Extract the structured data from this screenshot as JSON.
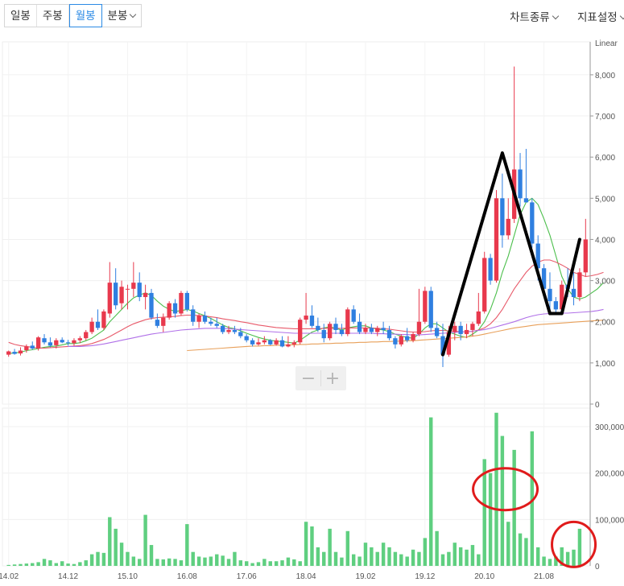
{
  "toolbar": {
    "period_tabs": [
      {
        "label": "일봉",
        "active": false
      },
      {
        "label": "주봉",
        "active": false
      },
      {
        "label": "월봉",
        "active": true
      },
      {
        "label": "분봉",
        "active": false,
        "dropdown": true
      }
    ],
    "chart_type_label": "차트종류",
    "indicator_label": "지표설정"
  },
  "zoom": {
    "minus": "−",
    "plus": "+"
  },
  "colors": {
    "up": "#e8394d",
    "down": "#2f7fe0",
    "volume": "#5fcf80",
    "ma5": "#4cbf4c",
    "ma20": "#e85a6a",
    "ma60": "#b070e8",
    "ma120": "#e8a05a",
    "annotation_line": "#000000",
    "annotation_circle": "#e01b1b"
  },
  "chart_data": {
    "type": "candlestick",
    "price_axis": {
      "label": "Linear",
      "ticks": [
        "0",
        "1,000",
        "2,000",
        "3,000",
        "4,000",
        "5,000",
        "6,000",
        "7,000",
        "8,000"
      ],
      "ylim": [
        0,
        8800
      ]
    },
    "volume_axis": {
      "ticks": [
        "0",
        "100,000,",
        "200,000,",
        "300,000,"
      ],
      "ylim": [
        0,
        340000
      ]
    },
    "x_ticks": [
      "14.02",
      "14.12",
      "15.10",
      "16.08",
      "17.06",
      "18.04",
      "19.02",
      "19.12",
      "20.10",
      "21.08"
    ],
    "candles": [
      {
        "o": 1200,
        "h": 1300,
        "l": 1150,
        "c": 1280
      },
      {
        "o": 1270,
        "h": 1340,
        "l": 1200,
        "c": 1220
      },
      {
        "o": 1230,
        "h": 1380,
        "l": 1180,
        "c": 1300
      },
      {
        "o": 1310,
        "h": 1450,
        "l": 1250,
        "c": 1400
      },
      {
        "o": 1420,
        "h": 1520,
        "l": 1320,
        "c": 1350
      },
      {
        "o": 1350,
        "h": 1650,
        "l": 1300,
        "c": 1620
      },
      {
        "o": 1600,
        "h": 1700,
        "l": 1450,
        "c": 1500
      },
      {
        "o": 1500,
        "h": 1620,
        "l": 1380,
        "c": 1420
      },
      {
        "o": 1430,
        "h": 1600,
        "l": 1350,
        "c": 1550
      },
      {
        "o": 1560,
        "h": 1620,
        "l": 1480,
        "c": 1500
      },
      {
        "o": 1500,
        "h": 1560,
        "l": 1420,
        "c": 1480
      },
      {
        "o": 1480,
        "h": 1600,
        "l": 1420,
        "c": 1550
      },
      {
        "o": 1550,
        "h": 1650,
        "l": 1480,
        "c": 1600
      },
      {
        "o": 1600,
        "h": 1800,
        "l": 1550,
        "c": 1750
      },
      {
        "o": 1750,
        "h": 2100,
        "l": 1700,
        "c": 2000
      },
      {
        "o": 2000,
        "h": 2300,
        "l": 1800,
        "c": 1850
      },
      {
        "o": 1850,
        "h": 2300,
        "l": 1800,
        "c": 2250
      },
      {
        "o": 2200,
        "h": 3450,
        "l": 2100,
        "c": 2950
      },
      {
        "o": 2950,
        "h": 3300,
        "l": 2300,
        "c": 2400
      },
      {
        "o": 2450,
        "h": 3000,
        "l": 2300,
        "c": 2850
      },
      {
        "o": 2800,
        "h": 2900,
        "l": 2300,
        "c": 2800
      },
      {
        "o": 2800,
        "h": 3450,
        "l": 2600,
        "c": 2950
      },
      {
        "o": 2950,
        "h": 3200,
        "l": 2500,
        "c": 2600
      },
      {
        "o": 2600,
        "h": 2900,
        "l": 2300,
        "c": 2700
      },
      {
        "o": 2700,
        "h": 2800,
        "l": 2050,
        "c": 2100
      },
      {
        "o": 2050,
        "h": 2200,
        "l": 1850,
        "c": 1900
      },
      {
        "o": 1900,
        "h": 2200,
        "l": 1750,
        "c": 2100
      },
      {
        "o": 2100,
        "h": 2500,
        "l": 2050,
        "c": 2450
      },
      {
        "o": 2450,
        "h": 2550,
        "l": 2100,
        "c": 2200
      },
      {
        "o": 2200,
        "h": 2750,
        "l": 2150,
        "c": 2700
      },
      {
        "o": 2700,
        "h": 2750,
        "l": 2250,
        "c": 2300
      },
      {
        "o": 2300,
        "h": 2400,
        "l": 1900,
        "c": 2000
      },
      {
        "o": 2000,
        "h": 2200,
        "l": 1850,
        "c": 2150
      },
      {
        "o": 2150,
        "h": 2250,
        "l": 1950,
        "c": 2000
      },
      {
        "o": 2000,
        "h": 2100,
        "l": 1900,
        "c": 1950
      },
      {
        "o": 1950,
        "h": 2100,
        "l": 1850,
        "c": 1900
      },
      {
        "o": 1900,
        "h": 1950,
        "l": 1700,
        "c": 1750
      },
      {
        "o": 1750,
        "h": 1900,
        "l": 1700,
        "c": 1800
      },
      {
        "o": 1800,
        "h": 1900,
        "l": 1700,
        "c": 1750
      },
      {
        "o": 1750,
        "h": 1850,
        "l": 1600,
        "c": 1650
      },
      {
        "o": 1650,
        "h": 1700,
        "l": 1500,
        "c": 1550
      },
      {
        "o": 1550,
        "h": 1600,
        "l": 1400,
        "c": 1450
      },
      {
        "o": 1450,
        "h": 1600,
        "l": 1420,
        "c": 1500
      },
      {
        "o": 1500,
        "h": 1650,
        "l": 1450,
        "c": 1550
      },
      {
        "o": 1550,
        "h": 1580,
        "l": 1430,
        "c": 1450
      },
      {
        "o": 1450,
        "h": 1600,
        "l": 1420,
        "c": 1550
      },
      {
        "o": 1550,
        "h": 1650,
        "l": 1380,
        "c": 1400
      },
      {
        "o": 1400,
        "h": 1650,
        "l": 1380,
        "c": 1450
      },
      {
        "o": 1450,
        "h": 1550,
        "l": 1380,
        "c": 1500
      },
      {
        "o": 1500,
        "h": 2100,
        "l": 1450,
        "c": 2050
      },
      {
        "o": 2050,
        "h": 2700,
        "l": 1950,
        "c": 2150
      },
      {
        "o": 2150,
        "h": 2400,
        "l": 1850,
        "c": 1900
      },
      {
        "o": 1900,
        "h": 2100,
        "l": 1750,
        "c": 1800
      },
      {
        "o": 1800,
        "h": 1950,
        "l": 1500,
        "c": 1600
      },
      {
        "o": 1600,
        "h": 2000,
        "l": 1550,
        "c": 1950
      },
      {
        "o": 1950,
        "h": 2100,
        "l": 1700,
        "c": 1800
      },
      {
        "o": 1800,
        "h": 1950,
        "l": 1650,
        "c": 1700
      },
      {
        "o": 1700,
        "h": 2350,
        "l": 1650,
        "c": 2300
      },
      {
        "o": 2300,
        "h": 2400,
        "l": 1950,
        "c": 2000
      },
      {
        "o": 2000,
        "h": 2200,
        "l": 1700,
        "c": 1750
      },
      {
        "o": 1750,
        "h": 1950,
        "l": 1700,
        "c": 1850
      },
      {
        "o": 1850,
        "h": 1950,
        "l": 1700,
        "c": 1750
      },
      {
        "o": 1750,
        "h": 1900,
        "l": 1650,
        "c": 1850
      },
      {
        "o": 1850,
        "h": 2000,
        "l": 1700,
        "c": 1800
      },
      {
        "o": 1800,
        "h": 1900,
        "l": 1550,
        "c": 1600
      },
      {
        "o": 1600,
        "h": 1650,
        "l": 1350,
        "c": 1450
      },
      {
        "o": 1450,
        "h": 1700,
        "l": 1400,
        "c": 1650
      },
      {
        "o": 1650,
        "h": 1850,
        "l": 1500,
        "c": 1550
      },
      {
        "o": 1550,
        "h": 1750,
        "l": 1500,
        "c": 1700
      },
      {
        "o": 1700,
        "h": 2800,
        "l": 1650,
        "c": 2000
      },
      {
        "o": 2000,
        "h": 2850,
        "l": 1950,
        "c": 2750
      },
      {
        "o": 2750,
        "h": 2850,
        "l": 1750,
        "c": 1850
      },
      {
        "o": 1850,
        "h": 2000,
        "l": 1600,
        "c": 1650
      },
      {
        "o": 1650,
        "h": 1950,
        "l": 900,
        "c": 1200
      },
      {
        "o": 1200,
        "h": 1900,
        "l": 1150,
        "c": 1750
      },
      {
        "o": 1750,
        "h": 2000,
        "l": 1550,
        "c": 1900
      },
      {
        "o": 1900,
        "h": 2000,
        "l": 1550,
        "c": 1700
      },
      {
        "o": 1700,
        "h": 1950,
        "l": 1600,
        "c": 1800
      },
      {
        "o": 1800,
        "h": 2000,
        "l": 1650,
        "c": 1950
      },
      {
        "o": 1950,
        "h": 2700,
        "l": 1900,
        "c": 2250
      },
      {
        "o": 2250,
        "h": 3700,
        "l": 2200,
        "c": 3550
      },
      {
        "o": 3550,
        "h": 3650,
        "l": 2900,
        "c": 3000
      },
      {
        "o": 3000,
        "h": 5200,
        "l": 2950,
        "c": 5000
      },
      {
        "o": 5000,
        "h": 5600,
        "l": 3800,
        "c": 4100
      },
      {
        "o": 4100,
        "h": 5000,
        "l": 4000,
        "c": 4500
      },
      {
        "o": 4500,
        "h": 8200,
        "l": 4400,
        "c": 5700
      },
      {
        "o": 5700,
        "h": 6100,
        "l": 4800,
        "c": 5000
      },
      {
        "o": 5000,
        "h": 6200,
        "l": 4900,
        "c": 4900
      },
      {
        "o": 4900,
        "h": 5000,
        "l": 3800,
        "c": 3900
      },
      {
        "o": 3900,
        "h": 4100,
        "l": 3000,
        "c": 3300
      },
      {
        "o": 3300,
        "h": 3400,
        "l": 2700,
        "c": 2800
      },
      {
        "o": 2800,
        "h": 3200,
        "l": 2300,
        "c": 2500
      },
      {
        "o": 2500,
        "h": 2600,
        "l": 2200,
        "c": 2300
      },
      {
        "o": 2300,
        "h": 3000,
        "l": 2200,
        "c": 2900
      },
      {
        "o": 2900,
        "h": 3300,
        "l": 2600,
        "c": 2800
      },
      {
        "o": 2800,
        "h": 3200,
        "l": 2400,
        "c": 2600
      },
      {
        "o": 2600,
        "h": 3300,
        "l": 2500,
        "c": 3200
      },
      {
        "o": 3200,
        "h": 4500,
        "l": 3100,
        "c": 4000
      }
    ],
    "volume": [
      2000,
      3000,
      4000,
      5000,
      6000,
      8000,
      15000,
      12000,
      6000,
      10000,
      5000,
      4000,
      8000,
      12000,
      25000,
      30000,
      28000,
      105000,
      80000,
      50000,
      30000,
      20000,
      15000,
      110000,
      45000,
      15000,
      14000,
      16000,
      15000,
      12000,
      90000,
      30000,
      20000,
      18000,
      20000,
      25000,
      22000,
      15000,
      30000,
      12000,
      10000,
      6000,
      8000,
      15000,
      10000,
      10000,
      12000,
      18000,
      14000,
      10000,
      95000,
      85000,
      40000,
      30000,
      80000,
      30000,
      18000,
      75000,
      25000,
      20000,
      50000,
      40000,
      30000,
      50000,
      40000,
      30000,
      25000,
      20000,
      35000,
      30000,
      60000,
      320000,
      75000,
      25000,
      30000,
      50000,
      40000,
      35000,
      45000,
      25000,
      230000,
      200000,
      330000,
      280000,
      95000,
      250000,
      70000,
      60000,
      290000,
      40000,
      20000,
      15000,
      20000,
      40000,
      30000,
      35000,
      80000
    ],
    "series": [
      {
        "name": "MA5",
        "values": [
          1230,
          1240,
          1260,
          1300,
          1320,
          1350,
          1380,
          1400,
          1410,
          1440,
          1470,
          1470,
          1490,
          1540,
          1600,
          1700,
          1800,
          2000,
          2150,
          2300,
          2450,
          2580,
          2650,
          2700,
          2640,
          2500,
          2380,
          2300,
          2250,
          2270,
          2300,
          2260,
          2200,
          2150,
          2080,
          2000,
          1920,
          1860,
          1830,
          1780,
          1720,
          1670,
          1620,
          1580,
          1550,
          1530,
          1520,
          1500,
          1480,
          1550,
          1650,
          1750,
          1800,
          1850,
          1880,
          1840,
          1800,
          1850,
          1880,
          1900,
          1900,
          1850,
          1820,
          1800,
          1760,
          1700,
          1650,
          1620,
          1600,
          1700,
          1850,
          1950,
          1950,
          1850,
          1750,
          1700,
          1650,
          1620,
          1700,
          1800,
          2000,
          2300,
          2700,
          3200,
          3600,
          4100,
          4600,
          4900,
          5000,
          4850,
          4500,
          4100,
          3600,
          3100,
          2800,
          2600,
          2550,
          2600,
          2700,
          2800,
          2950
        ]
      },
      {
        "name": "MA20",
        "values": [
          1500,
          1450,
          1420,
          1400,
          1380,
          1360,
          1360,
          1370,
          1380,
          1390,
          1400,
          1410,
          1420,
          1440,
          1470,
          1520,
          1570,
          1640,
          1720,
          1800,
          1880,
          1950,
          2000,
          2050,
          2080,
          2100,
          2110,
          2120,
          2130,
          2150,
          2160,
          2160,
          2150,
          2140,
          2120,
          2100,
          2070,
          2050,
          2030,
          2000,
          1980,
          1950,
          1920,
          1900,
          1880,
          1860,
          1850,
          1840,
          1830,
          1830,
          1830,
          1830,
          1830,
          1840,
          1840,
          1840,
          1840,
          1850,
          1850,
          1850,
          1850,
          1850,
          1840,
          1830,
          1820,
          1800,
          1780,
          1760,
          1750,
          1750,
          1760,
          1780,
          1790,
          1790,
          1780,
          1770,
          1760,
          1750,
          1770,
          1800,
          1850,
          1950,
          2100,
          2300,
          2550,
          2800,
          3000,
          3200,
          3350,
          3450,
          3500,
          3500,
          3450,
          3380,
          3300,
          3200,
          3150,
          3100,
          3120,
          3150,
          3200
        ]
      },
      {
        "name": "MA60",
        "values": [
          null,
          null,
          null,
          null,
          null,
          null,
          null,
          null,
          null,
          null,
          1400,
          1400,
          1400,
          1410,
          1420,
          1440,
          1460,
          1490,
          1520,
          1550,
          1580,
          1610,
          1640,
          1670,
          1700,
          1720,
          1740,
          1760,
          1780,
          1800,
          1810,
          1820,
          1830,
          1840,
          1840,
          1840,
          1840,
          1830,
          1820,
          1810,
          1800,
          1790,
          1780,
          1770,
          1760,
          1750,
          1740,
          1730,
          1720,
          1720,
          1720,
          1720,
          1720,
          1720,
          1720,
          1720,
          1720,
          1720,
          1720,
          1720,
          1720,
          1720,
          1710,
          1710,
          1700,
          1700,
          1690,
          1690,
          1680,
          1680,
          1690,
          1700,
          1710,
          1720,
          1730,
          1740,
          1750,
          1760,
          1770,
          1790,
          1810,
          1840,
          1880,
          1920,
          1960,
          2000,
          2050,
          2100,
          2140,
          2170,
          2190,
          2200,
          2210,
          2210,
          2210,
          2220,
          2230,
          2240,
          2250,
          2270,
          2300
        ]
      },
      {
        "name": "MA120",
        "values": [
          null,
          null,
          null,
          null,
          null,
          null,
          null,
          null,
          null,
          null,
          null,
          null,
          null,
          null,
          null,
          null,
          null,
          null,
          null,
          null,
          null,
          null,
          null,
          null,
          null,
          null,
          null,
          null,
          null,
          null,
          1300,
          1310,
          1320,
          1330,
          1340,
          1350,
          1360,
          1370,
          1380,
          1390,
          1400,
          1410,
          1410,
          1420,
          1420,
          1430,
          1430,
          1440,
          1440,
          1450,
          1450,
          1460,
          1460,
          1470,
          1470,
          1480,
          1480,
          1490,
          1490,
          1500,
          1500,
          1510,
          1510,
          1520,
          1520,
          1530,
          1530,
          1540,
          1540,
          1550,
          1560,
          1570,
          1580,
          1590,
          1600,
          1610,
          1620,
          1630,
          1650,
          1670,
          1700,
          1730,
          1760,
          1790,
          1820,
          1850,
          1870,
          1890,
          1910,
          1930,
          1940,
          1950,
          1960,
          1970,
          1980,
          1990,
          2000,
          2010,
          2020,
          2030,
          2040
        ]
      }
    ]
  }
}
